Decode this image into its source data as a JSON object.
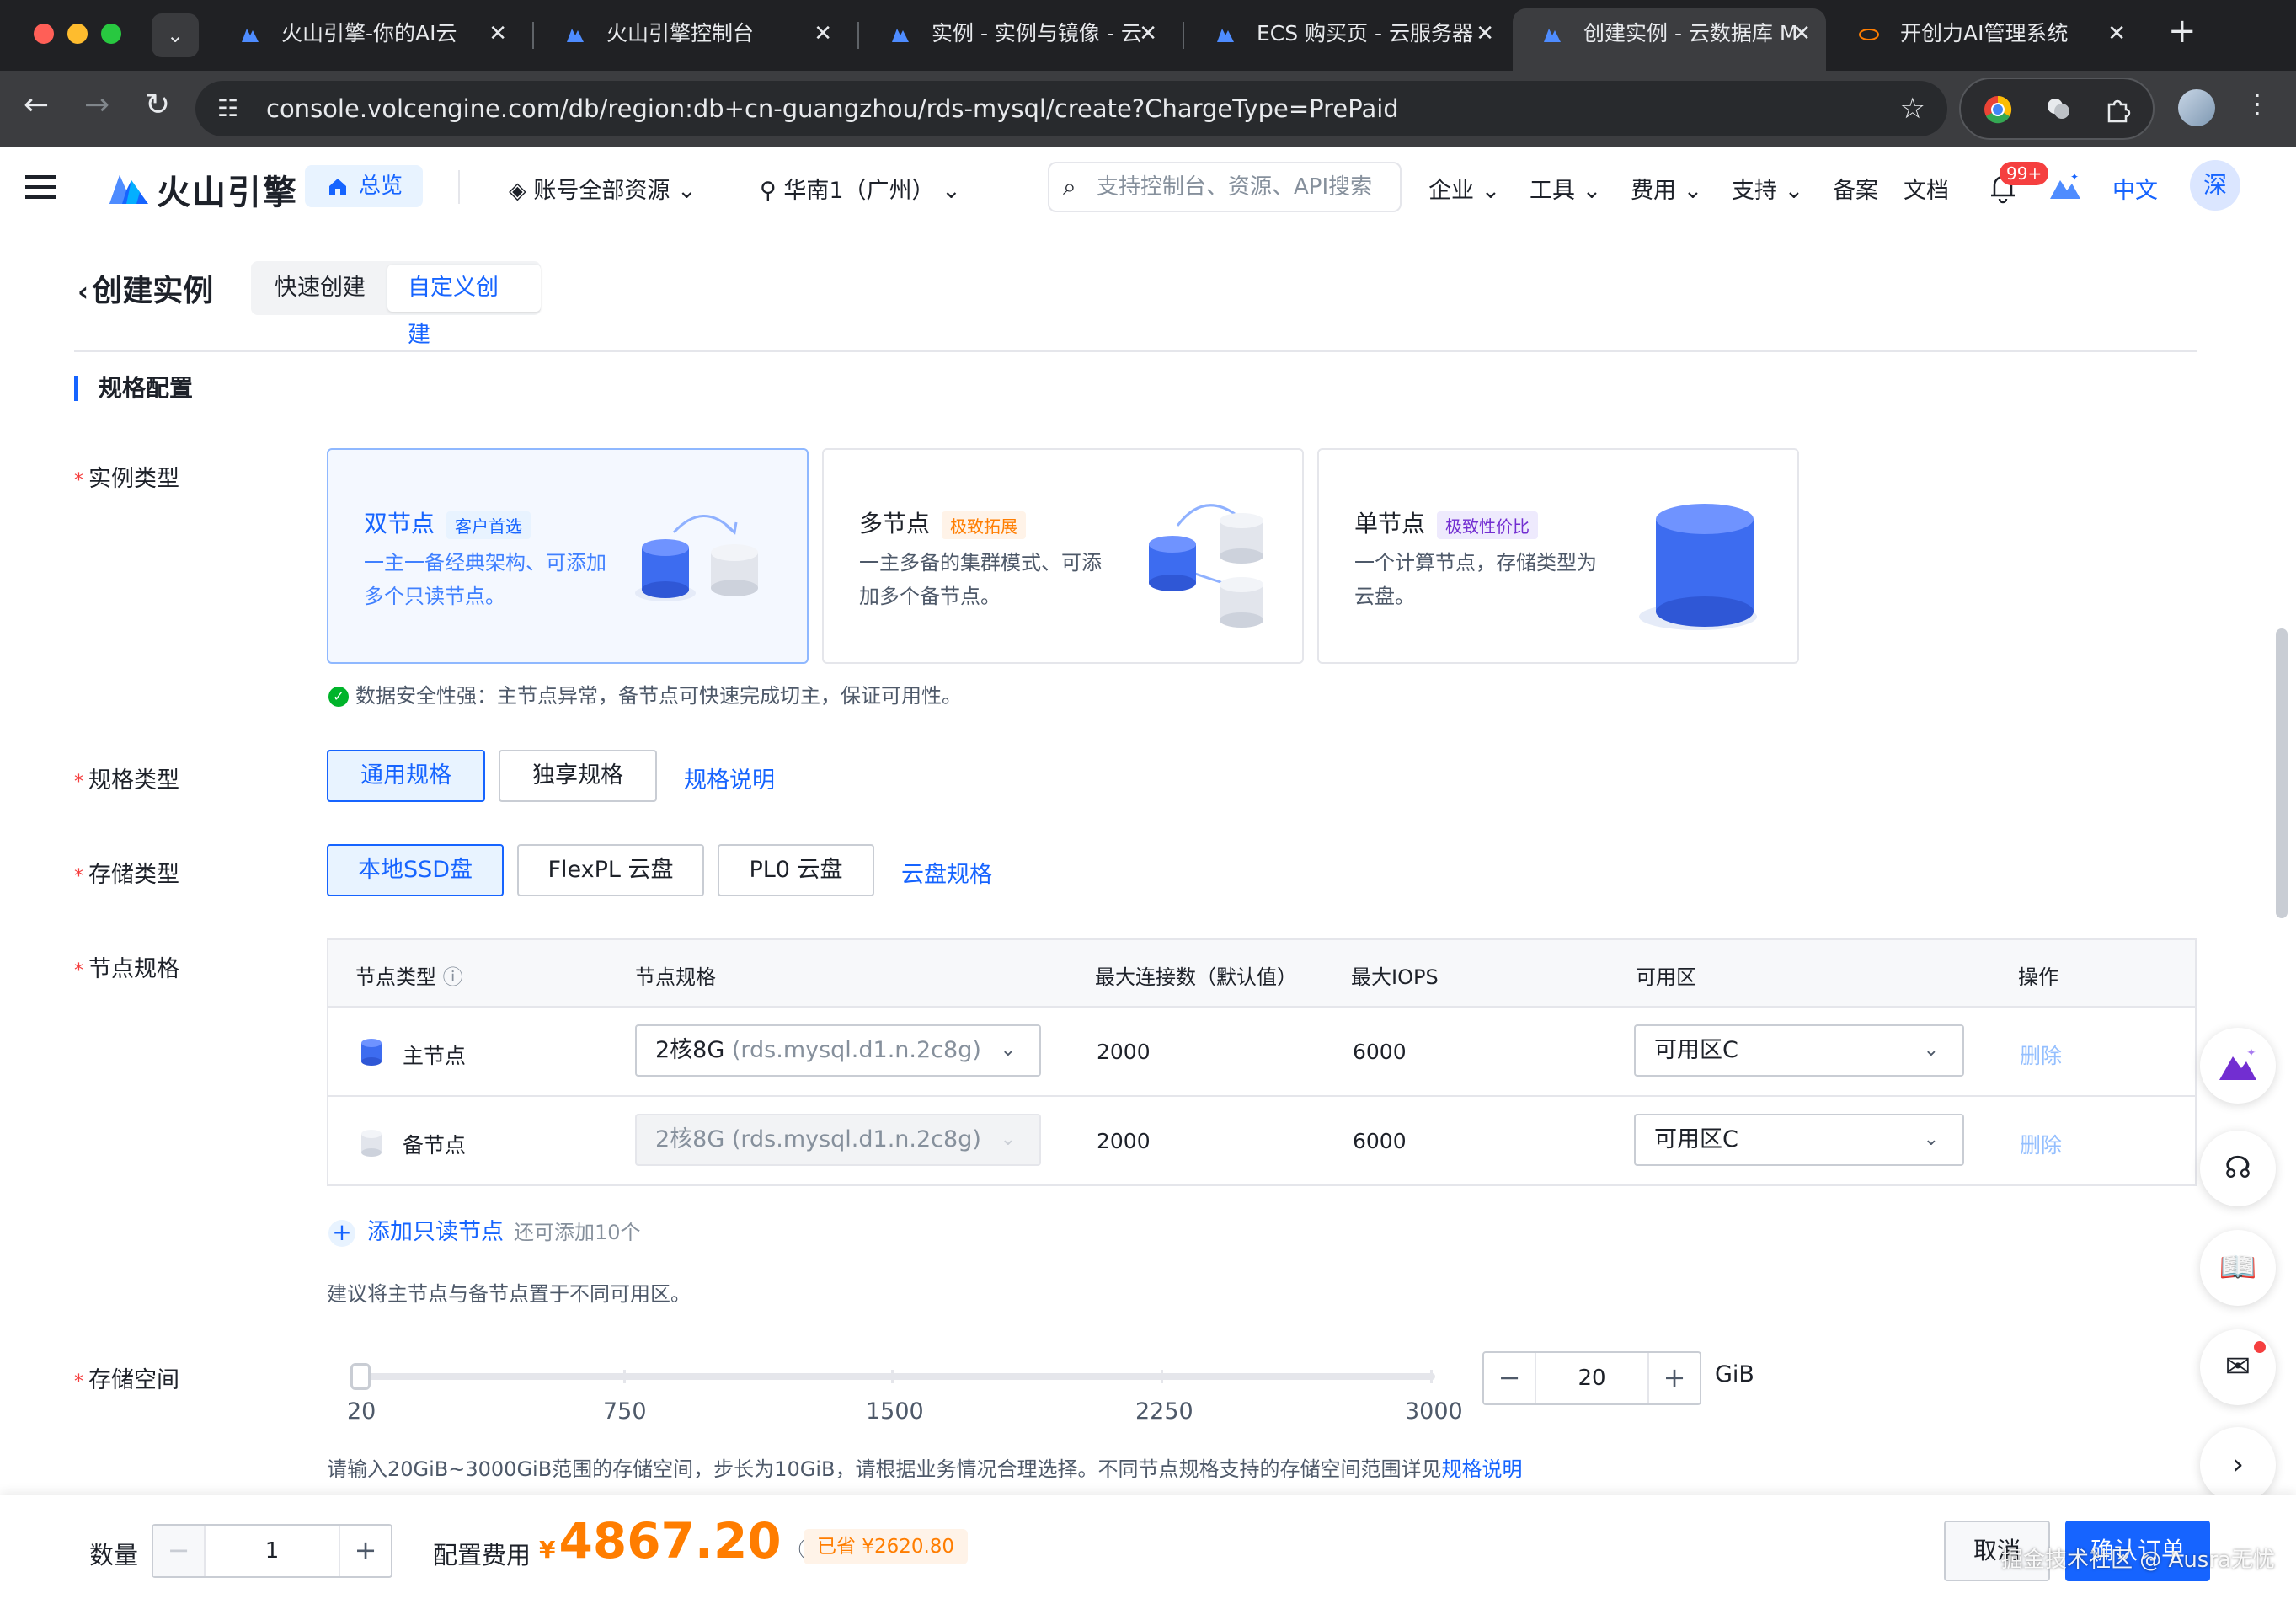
{
  "browser": {
    "tabs": [
      {
        "title": "火山引擎-你的AI云",
        "active": false
      },
      {
        "title": "火山引擎控制台",
        "active": false
      },
      {
        "title": "实例 - 实例与镜像 - 云",
        "active": false
      },
      {
        "title": "ECS 购买页 - 云服务器",
        "active": false
      },
      {
        "title": "创建实例 - 云数据库 M",
        "active": true
      },
      {
        "title": "开创力AI管理系统",
        "active": false
      }
    ],
    "url": "console.volcengine.com/db/region:db+cn-guangzhou/rds-mysql/create?ChargeType=PrePaid"
  },
  "header": {
    "logo": "火山引擎",
    "home": "总览",
    "account": "账号全部资源",
    "region": "华南1（广州）",
    "search_placeholder": "支持控制台、资源、API搜索",
    "nav": [
      "企业",
      "工具",
      "费用",
      "支持",
      "备案",
      "文档"
    ],
    "badge": "99+",
    "lang": "中文",
    "avatar": "深"
  },
  "page": {
    "title": "创建实例",
    "tabs": [
      "快速创建",
      "自定义创建"
    ],
    "section": "规格配置"
  },
  "instance_type": {
    "label": "实例类型",
    "cards": [
      {
        "title": "双节点",
        "tag": "客户首选",
        "desc": "一主一备经典架构、可添加多个只读节点。",
        "selected": true
      },
      {
        "title": "多节点",
        "tag": "极致拓展",
        "desc": "一主多备的集群模式、可添加多个备节点。",
        "selected": false
      },
      {
        "title": "单节点",
        "tag": "极致性价比",
        "desc": "一个计算节点，存储类型为云盘。",
        "selected": false
      }
    ],
    "note": "数据安全性强：主节点异常，备节点可快速完成切主，保证可用性。"
  },
  "spec_type": {
    "label": "规格类型",
    "options": [
      "通用规格",
      "独享规格"
    ],
    "selected": "通用规格",
    "link": "规格说明"
  },
  "storage_type": {
    "label": "存储类型",
    "options": [
      "本地SSD盘",
      "FlexPL 云盘",
      "PL0 云盘"
    ],
    "selected": "本地SSD盘",
    "link": "云盘规格"
  },
  "node_spec": {
    "label": "节点规格",
    "columns": [
      "节点类型",
      "节点规格",
      "最大连接数（默认值）",
      "最大IOPS",
      "可用区",
      "操作"
    ],
    "rows": [
      {
        "type": "主节点",
        "spec": "2核8G",
        "spec_code": "(rds.mysql.d1.n.2c8g)",
        "connections": "2000",
        "iops": "6000",
        "zone": "可用区C",
        "action": "删除"
      },
      {
        "type": "备节点",
        "spec": "2核8G",
        "spec_code": "(rds.mysql.d1.n.2c8g)",
        "connections": "2000",
        "iops": "6000",
        "zone": "可用区C",
        "action": "删除"
      }
    ],
    "add_readonly": "添加只读节点",
    "add_hint": "还可添加10个",
    "suggest": "建议将主节点与备节点置于不同可用区。"
  },
  "storage": {
    "label": "存储空间",
    "ticks": [
      "20",
      "750",
      "1500",
      "2250",
      "3000"
    ],
    "value": "20",
    "unit": "GiB",
    "hint": "请输入20GiB~3000GiB范围的存储空间，步长为10GiB，请根据业务情况合理选择。不同节点规格支持的存储空间范围详见",
    "hint_link": "规格说明"
  },
  "footer": {
    "qty_label": "数量",
    "qty": "1",
    "fee_label": "配置费用",
    "currency": "¥",
    "price": "4867.20",
    "saved": "已省 ¥2620.80",
    "cancel": "取消",
    "confirm": "确认订单",
    "watermark": "掘金技术社区 @ Ausra无忧"
  },
  "colors": {
    "accent": "#1664ff",
    "price": "#ff7d00",
    "required": "#f53f3f"
  }
}
